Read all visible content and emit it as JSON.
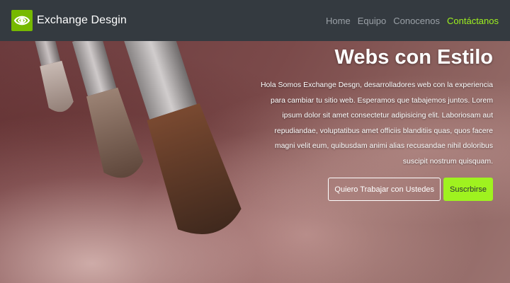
{
  "navbar": {
    "brand": "Exchange Desgin",
    "links": [
      {
        "label": "Home"
      },
      {
        "label": "Equipo"
      },
      {
        "label": "Conocenos"
      },
      {
        "label": "Contáctanos",
        "active": true
      }
    ]
  },
  "hero": {
    "title": "Webs con Estilo",
    "text": "Hola Somos Exchange Desgn, desarrolladores web con la experiencia para cambiar tu sitio web. Esperamos que tabajemos juntos. Lorem ipsum dolor sit amet consectetur adipisicing elit. Laboriosam aut repudiandae, voluptatibus amet officiis blanditiis quas, quos facere magni velit eum, quibusdam animi alias recusandae nihil doloribus suscipit nostrum quisquam.",
    "primary_button": "Quiero Trabajar con Ustedes",
    "secondary_button": "Suscrbirse"
  },
  "colors": {
    "navbar_bg": "#343a40",
    "accent": "#9ff21f",
    "logo_bg": "#76b900"
  },
  "icons": {
    "logo": "nvidia-eye-icon"
  }
}
